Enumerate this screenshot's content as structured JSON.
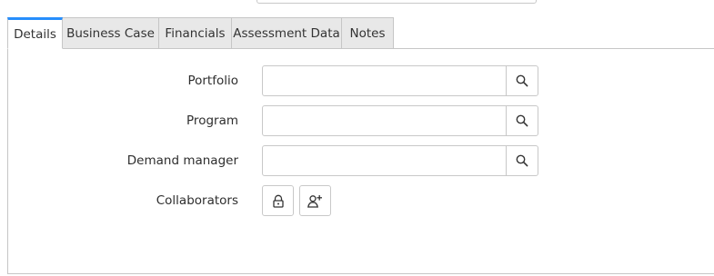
{
  "tabs": [
    {
      "label": "Details",
      "active": true
    },
    {
      "label": "Business Case",
      "active": false
    },
    {
      "label": "Financials",
      "active": false
    },
    {
      "label": "Assessment Data",
      "active": false
    },
    {
      "label": "Notes",
      "active": false
    }
  ],
  "form": {
    "portfolio": {
      "label": "Portfolio",
      "value": "",
      "icon": "search-icon"
    },
    "program": {
      "label": "Program",
      "value": "",
      "icon": "search-icon"
    },
    "demand_manager": {
      "label": "Demand manager",
      "value": "",
      "icon": "search-icon"
    },
    "collaborators": {
      "label": "Collaborators",
      "lock_icon": "lock-icon",
      "add_icon": "add-user-icon"
    }
  },
  "colors": {
    "active_tab_accent": "#278efc",
    "tab_background": "#e8e8e8",
    "border": "#c6c6c6"
  }
}
